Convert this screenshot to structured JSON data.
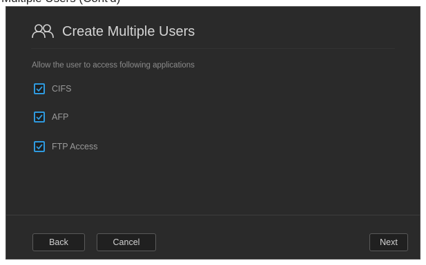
{
  "page_header_fragment": "Multiple Users (Cont'd)",
  "dialog": {
    "title": "Create Multiple Users",
    "title_icon": "users-icon",
    "instruction": "Allow the user to access following applications",
    "options": [
      {
        "label": "CIFS",
        "checked": true
      },
      {
        "label": "AFP",
        "checked": true
      },
      {
        "label": "FTP Access",
        "checked": true
      }
    ]
  },
  "footer": {
    "back_label": "Back",
    "cancel_label": "Cancel",
    "next_label": "Next"
  },
  "colors": {
    "dialog_background": "#2a2a2a",
    "accent": "#2f9be0",
    "text_primary": "#d4d4d4",
    "text_secondary": "#8c8c8c"
  }
}
